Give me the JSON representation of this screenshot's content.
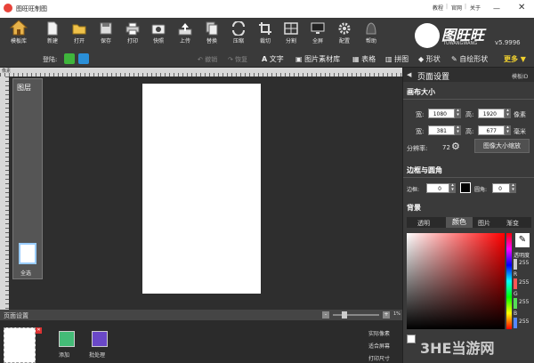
{
  "app": {
    "title": "图旺旺制图",
    "links": [
      "教程",
      "官网",
      "关于"
    ],
    "brand": "图旺旺",
    "brand_sub": "TUWANGWANG",
    "version": "v5.9996"
  },
  "toolbar": {
    "home_label": "模板库",
    "items": [
      "新建",
      "打开",
      "保存",
      "打印",
      "快照",
      "上传",
      "替换",
      "压缩",
      "裁切",
      "分割",
      "全屏",
      "配置",
      "帮助"
    ]
  },
  "subbar": {
    "login_label": "登陆:",
    "undo_label": "撤销",
    "redo_label": "恢复",
    "tools": [
      "文字",
      "图片素材库",
      "表格",
      "拼图",
      "形状",
      "自绘形状"
    ],
    "more_label": "更多"
  },
  "ruler": {
    "label": "像素"
  },
  "layers": {
    "title": "图层",
    "select_all": "全选"
  },
  "right": {
    "title": "页面设置",
    "template_id_label": "模板ID",
    "canvas_size": {
      "title": "画布大小",
      "width_label": "宽:",
      "height_label": "高:",
      "px_width": "1080",
      "px_height": "1920",
      "px_unit": "像素",
      "mm_width": "381",
      "mm_height": "677",
      "mm_unit": "毫米",
      "resolution_label": "分辨率:",
      "resolution": "72",
      "resize_button": "图像大小缩放"
    },
    "border": {
      "title": "边框与圆角",
      "border_label": "边框:",
      "border_value": "0",
      "corner_label": "圆角:",
      "corner_value": "0"
    },
    "background": {
      "title": "背景",
      "tabs": [
        "透明",
        "颜色",
        "图片",
        "渐变"
      ],
      "active_tab": "颜色",
      "opacity_label": "透明度",
      "opacity": "255",
      "r_label": "R",
      "r": "255",
      "g_label": "G",
      "g": "255",
      "b_label": "B",
      "b": "255"
    }
  },
  "bottom": {
    "page_settings": "页面设置",
    "add_label": "添加",
    "batch_label": "批处理",
    "actions": [
      "实际像素",
      "适合屏幕",
      "打印尺寸"
    ],
    "zoom_text": "1%"
  },
  "watermark": "3HE当游网"
}
